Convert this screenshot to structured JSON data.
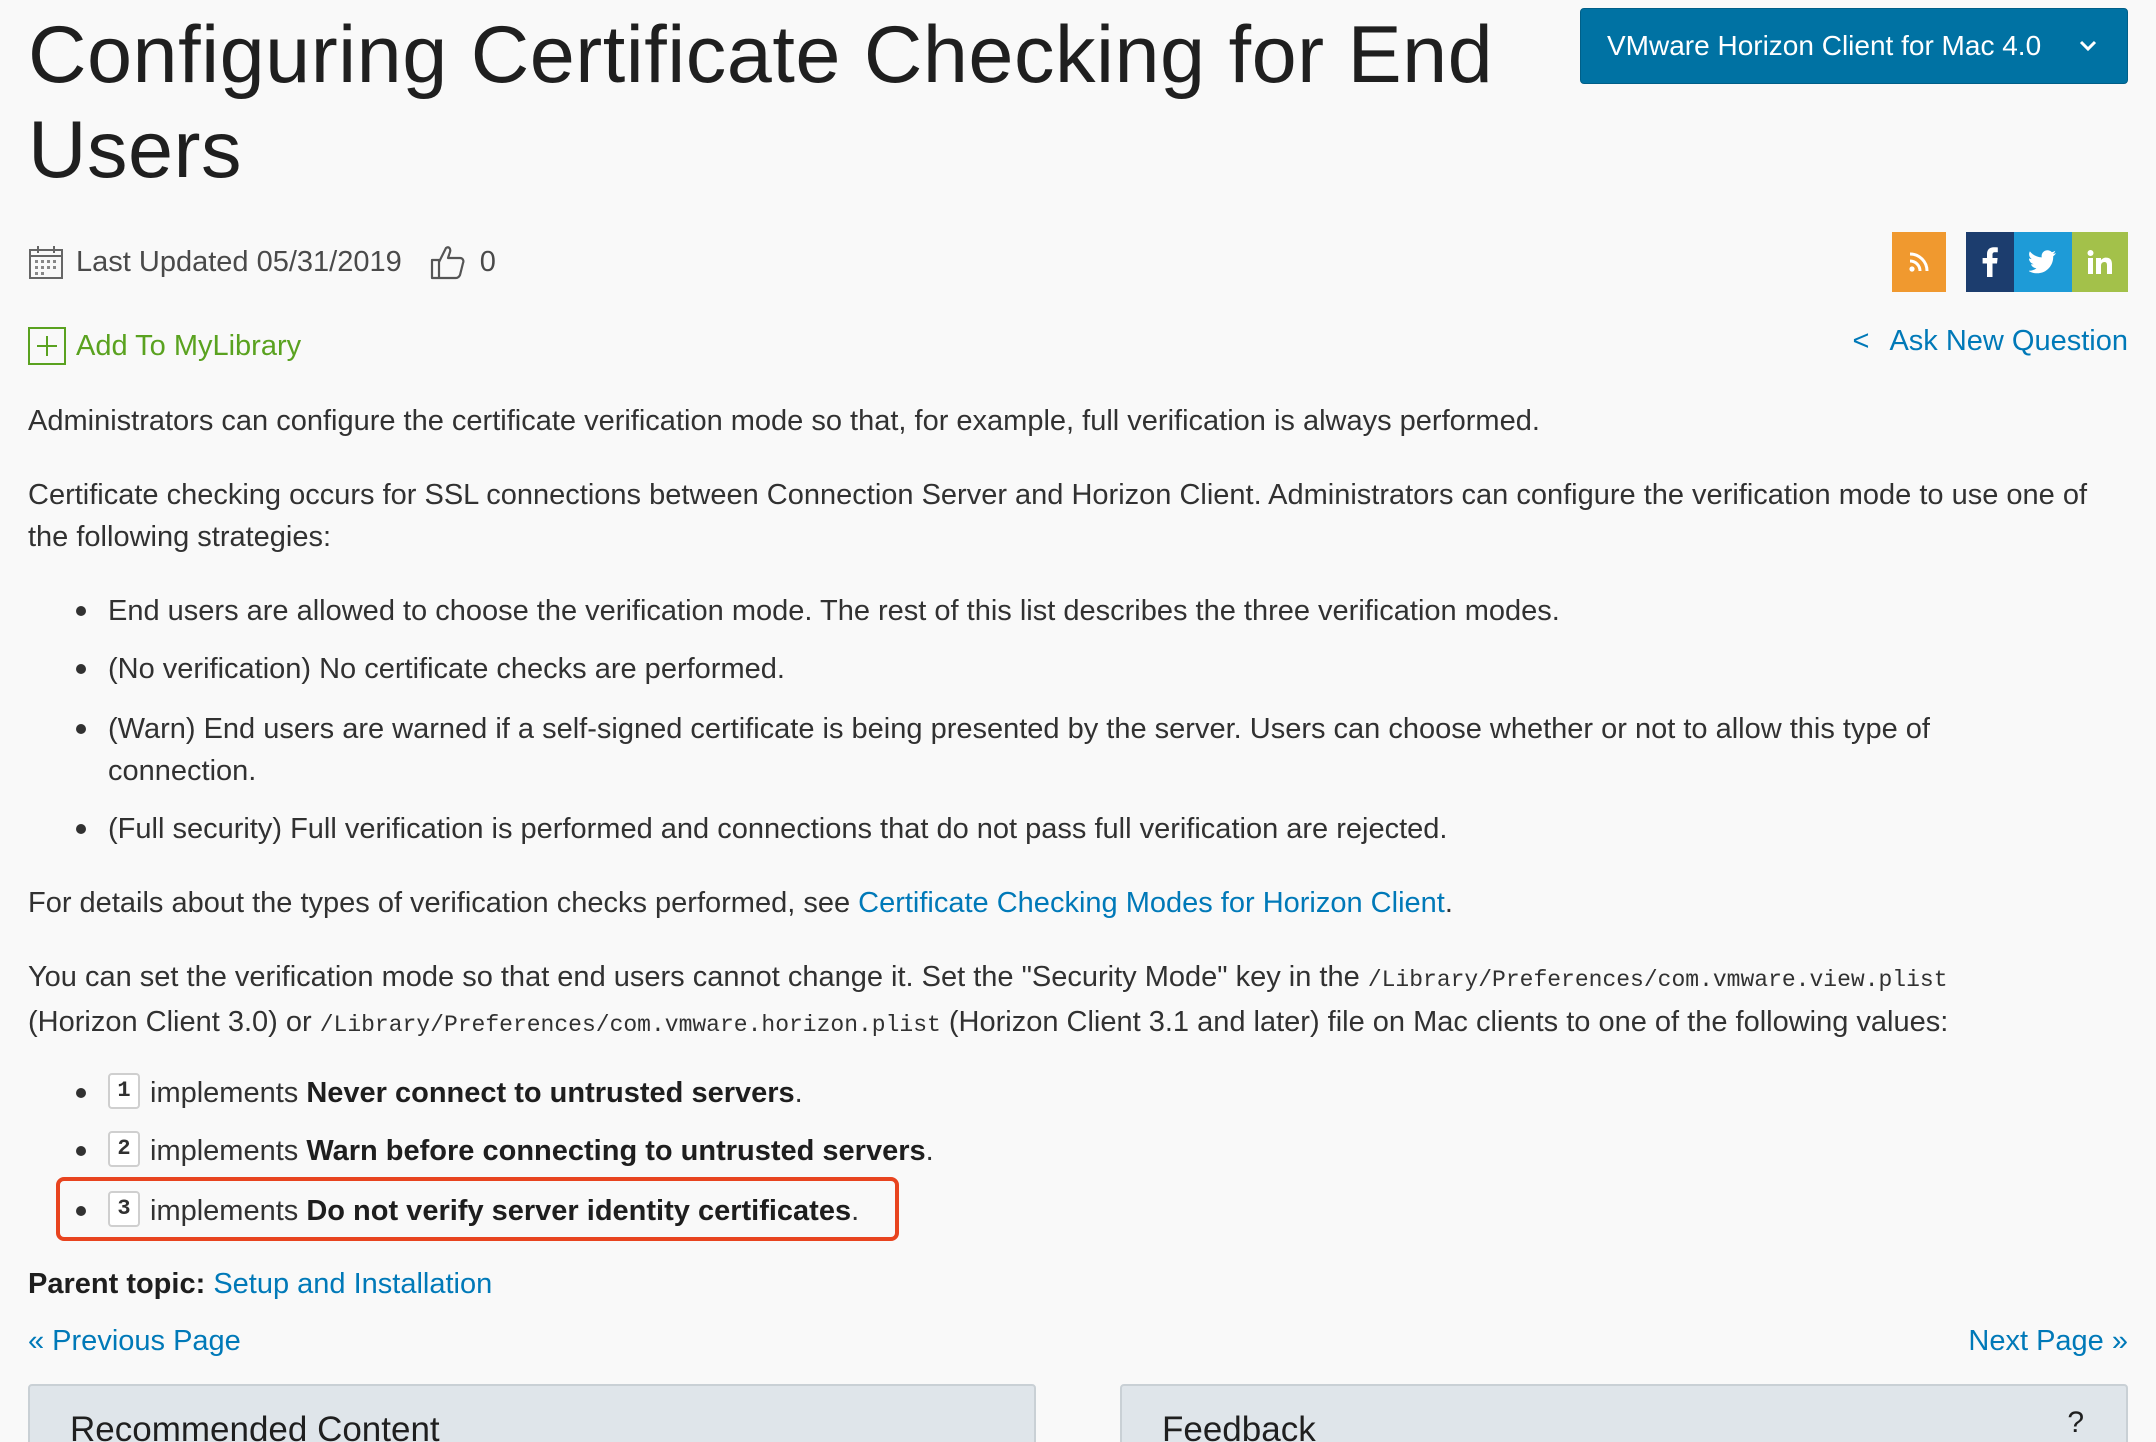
{
  "title": "Configuring Certificate Checking for End Users",
  "version_dropdown": {
    "label": "VMware Horizon Client for Mac 4.0"
  },
  "meta": {
    "last_updated": "Last Updated 05/31/2019",
    "likes": "0"
  },
  "add_library": "Add To MyLibrary",
  "ask_question": {
    "arrow": "<",
    "label": "Ask New Question"
  },
  "paragraphs": {
    "p1": "Administrators can configure the certificate verification mode so that, for example, full verification is always performed.",
    "p2": "Certificate checking occurs for SSL connections between Connection Server and Horizon Client. Administrators can configure the verification mode to use one of the following strategies:",
    "p3_pre": "For details about the types of verification checks performed, see ",
    "p3_link": "Certificate Checking Modes for Horizon Client",
    "p3_post": ".",
    "p4_a": "You can set the verification mode so that end users cannot change it. Set the \"Security Mode\" key in the ",
    "p4_code1": "/Library/Preferences/com.vmware.view.plist",
    "p4_b": "(Horizon Client 3.0) or ",
    "p4_code2": "/Library/Preferences/com.vmware.horizon.plist",
    "p4_c": " (Horizon Client 3.1 and later) file on Mac clients to one of the following values:"
  },
  "strategies": [
    "End users are allowed to choose the verification mode. The rest of this list describes the three verification modes.",
    "(No verification) No certificate checks are performed.",
    "(Warn) End users are warned if a self-signed certificate is being presented by the server. Users can choose whether or not to allow this type of connection.",
    "(Full security) Full verification is performed and connections that do not pass full verification are rejected."
  ],
  "values": [
    {
      "key": "1",
      "pre": "implements ",
      "bold": "Never connect to untrusted servers",
      "post": "."
    },
    {
      "key": "2",
      "pre": "implements ",
      "bold": "Warn before connecting to untrusted servers",
      "post": "."
    },
    {
      "key": "3",
      "pre": "implements ",
      "bold": "Do not verify server identity certificates",
      "post": "."
    }
  ],
  "parent_topic": {
    "label": "Parent topic:",
    "link": "Setup and Installation"
  },
  "nav": {
    "prev": "« Previous Page",
    "next": "Next Page »"
  },
  "cards": {
    "recommended": "Recommended Content",
    "feedback": "Feedback",
    "feedback_icon": "?"
  },
  "icons": [
    "calendar-icon",
    "thumbs-up-icon",
    "chevron-down-icon",
    "rss-icon",
    "facebook-icon",
    "twitter-icon",
    "linkedin-icon",
    "plus-box-icon"
  ],
  "colors": {
    "accent": "#0079b8",
    "dropdown_bg": "#0072a3",
    "library_green": "#5aa220",
    "highlight": "#e8441f",
    "rss": "#f0992f",
    "facebook": "#1c3d6e",
    "twitter": "#1e9bd7",
    "linkedin": "#a3c14a"
  }
}
